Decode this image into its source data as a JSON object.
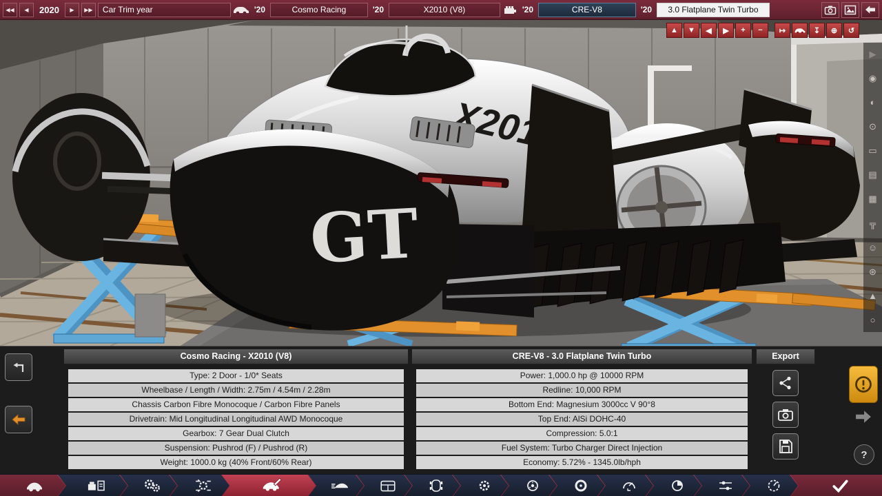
{
  "top_bar": {
    "nav_first": "◀◀",
    "nav_prev": "◀",
    "year": "2020",
    "nav_next": "▶",
    "nav_last": "▶▶",
    "trim_year_field": "Car Trim year",
    "car_year_badge": "'20",
    "model_field": "Cosmo Racing",
    "trim_year_badge": "'20",
    "trim_field": "X2010 (V8)",
    "engine_year_badge": "'20",
    "engine_field": "CRE-V8",
    "variant_year_badge": "'20",
    "variant_field": "3.0 Flatplane Twin Turbo",
    "icons": [
      "car-icon",
      "engine-icon",
      "photo-camera-icon",
      "image-icon",
      "back-arrow-icon"
    ]
  },
  "photo_controls": {
    "up": "▲",
    "down": "▼",
    "left": "◀",
    "right": "▶",
    "zoom_in": "+",
    "zoom_out": "−",
    "snap_wall": "↦",
    "vehicle_icon": "car-icon",
    "drop": "↧",
    "center": "⊕",
    "rotate": "↺"
  },
  "right_strip": [
    {
      "name": "play",
      "glyph": "▶"
    },
    {
      "name": "skybox",
      "glyph": "◉"
    },
    {
      "name": "contrast",
      "glyph": "◐"
    },
    {
      "name": "aperture",
      "glyph": "⊙"
    },
    {
      "name": "frame",
      "glyph": "▭"
    },
    {
      "name": "screen",
      "glyph": "▤"
    },
    {
      "name": "grid",
      "glyph": "▦"
    },
    {
      "name": "lift",
      "glyph": "╦"
    },
    {
      "name": "expression",
      "glyph": "☺"
    },
    {
      "name": "settings",
      "glyph": "⊛"
    },
    {
      "name": "raise",
      "glyph": "▲"
    },
    {
      "name": "orbit",
      "glyph": "○"
    }
  ],
  "scene": {
    "decal_side": "X2010",
    "decal_wheel_cover": "GT"
  },
  "info_panel": {
    "car": {
      "header": "Cosmo Racing - X2010 (V8)",
      "rows": [
        "Type: 2 Door - 1/0* Seats",
        "Wheelbase / Length / Width: 2.75m / 4.54m / 2.28m",
        "Chassis Carbon Fibre Monocoque / Carbon Fibre Panels",
        "Drivetrain: Mid Longitudinal Longitudinal AWD Monocoque",
        "Gearbox: 7 Gear Dual Clutch",
        "Suspension: Pushrod (F) / Pushrod (R)",
        "Weight: 1000.0 kg (40% Front/60% Rear)"
      ]
    },
    "engine": {
      "header": "CRE-V8 - 3.0 Flatplane Twin Turbo",
      "rows": [
        "Power: 1,000.0 hp @ 10000 RPM",
        "Redline: 10,000 RPM",
        "Bottom End: Magnesium 3000cc V 90°8",
        "Top End: AlSi DOHC-40",
        "Compression: 5.0:1",
        "Fuel System: Turbo Charger Direct Injection",
        "Economy: 5.72% - 1345.0lb/hph"
      ]
    },
    "export_header": "Export",
    "export_icons": [
      "share-icon",
      "screenshot-icon",
      "save-icon"
    ],
    "help_label": "?"
  },
  "bottom_tabs": [
    {
      "name": "models",
      "icon": "car-icon"
    },
    {
      "name": "engines",
      "icon": "engine-document-icon"
    },
    {
      "name": "gearbox",
      "icon": "gears-icon"
    },
    {
      "name": "drivetrain",
      "icon": "gear-arrows-icon"
    },
    {
      "name": "trim-design",
      "icon": "car-edit-icon",
      "active": true
    },
    {
      "name": "aerodynamics",
      "icon": "car-aero-icon"
    },
    {
      "name": "body-panels",
      "icon": "panel-icon"
    },
    {
      "name": "chassis-top",
      "icon": "car-top-icon"
    },
    {
      "name": "gearing",
      "icon": "gear-icon"
    },
    {
      "name": "brakes",
      "icon": "brake-disc-icon"
    },
    {
      "name": "wheels",
      "icon": "wheel-icon"
    },
    {
      "name": "dyno",
      "icon": "gauge-l-icon"
    },
    {
      "name": "tyres",
      "icon": "wheel-pie-icon"
    },
    {
      "name": "tuning",
      "icon": "sliders-icon"
    },
    {
      "name": "testing",
      "icon": "gauge-icon"
    },
    {
      "name": "summary",
      "icon": "check-icon"
    }
  ],
  "colors": {
    "topbar_maroon": "#6e2433",
    "selected_navy": "#253649",
    "accent_red": "#a82f3e",
    "warning_amber": "#e7a613",
    "lift_blue": "#67b1df",
    "lift_orange": "#e2902c"
  }
}
